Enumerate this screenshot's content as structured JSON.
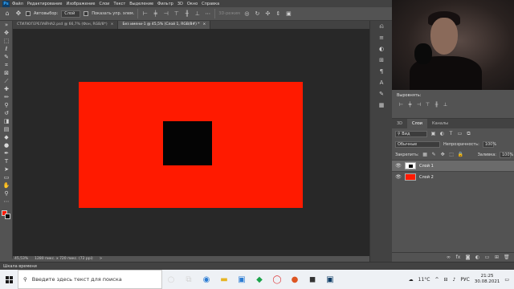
{
  "app": {
    "logo": "Ps",
    "menu": [
      "Файл",
      "Редактирование",
      "Изображение",
      "Слои",
      "Текст",
      "Выделение",
      "Фильтр",
      "3D",
      "Окно",
      "Справка"
    ]
  },
  "options": {
    "autoselect_label": "Автовыбор:",
    "autoselect_value": "Слой",
    "show_controls_label": "Показать упр. элем.",
    "mode_3d": "3D-режим"
  },
  "tabs": [
    {
      "label": "СТИЛЮГЕРЕЛАЙНА2.psd @ 66,7% (Фон, RGB/8*)",
      "close": "×"
    },
    {
      "label": "Без имени-1 @ 45,5% (Слой 1, RGB/8#) *",
      "close": "×"
    }
  ],
  "status": {
    "zoom": "45,53%",
    "doc_size": "1280 пикс. x 720 пикс. (72 ppi)",
    "arrow": ">"
  },
  "timeline_label": "Шкала времени",
  "panels": {
    "align_title": "Выровнять:",
    "tabs": [
      "3D",
      "Слои",
      "Каналы"
    ],
    "search_kind": "Вид",
    "blend_mode": "Обычные",
    "opacity_label": "Непрозрачность:",
    "opacity_value": "100%",
    "lock_label": "Закрепить:",
    "fill_label": "Заливка:",
    "fill_value": "100%",
    "layers": [
      {
        "name": "Слой 1",
        "selected": true
      },
      {
        "name": "Слой 2",
        "selected": false
      }
    ]
  },
  "taskbar": {
    "search_placeholder": "Введите здесь текст для поиска",
    "weather": "11°C",
    "lang": "РУС",
    "time": "21:25",
    "date": "30.08.2021"
  },
  "colors": {
    "accent_red": "#ff1a00",
    "black_square": "#040404",
    "canvas_bg": "#282828",
    "ui_bg": "#535353"
  },
  "icons": [
    "move-tool-icon",
    "marquee-tool-icon",
    "lasso-tool-icon",
    "quick-select-tool-icon",
    "crop-tool-icon",
    "eyedropper-tool-icon",
    "healing-brush-icon",
    "brush-tool-icon",
    "clone-stamp-icon",
    "history-brush-icon",
    "eraser-tool-icon",
    "gradient-tool-icon",
    "blur-tool-icon",
    "dodge-tool-icon",
    "pen-tool-icon",
    "type-tool-icon",
    "path-select-icon",
    "rectangle-tool-icon",
    "hand-tool-icon",
    "zoom-tool-icon",
    "eye-icon",
    "windows-logo-icon"
  ]
}
